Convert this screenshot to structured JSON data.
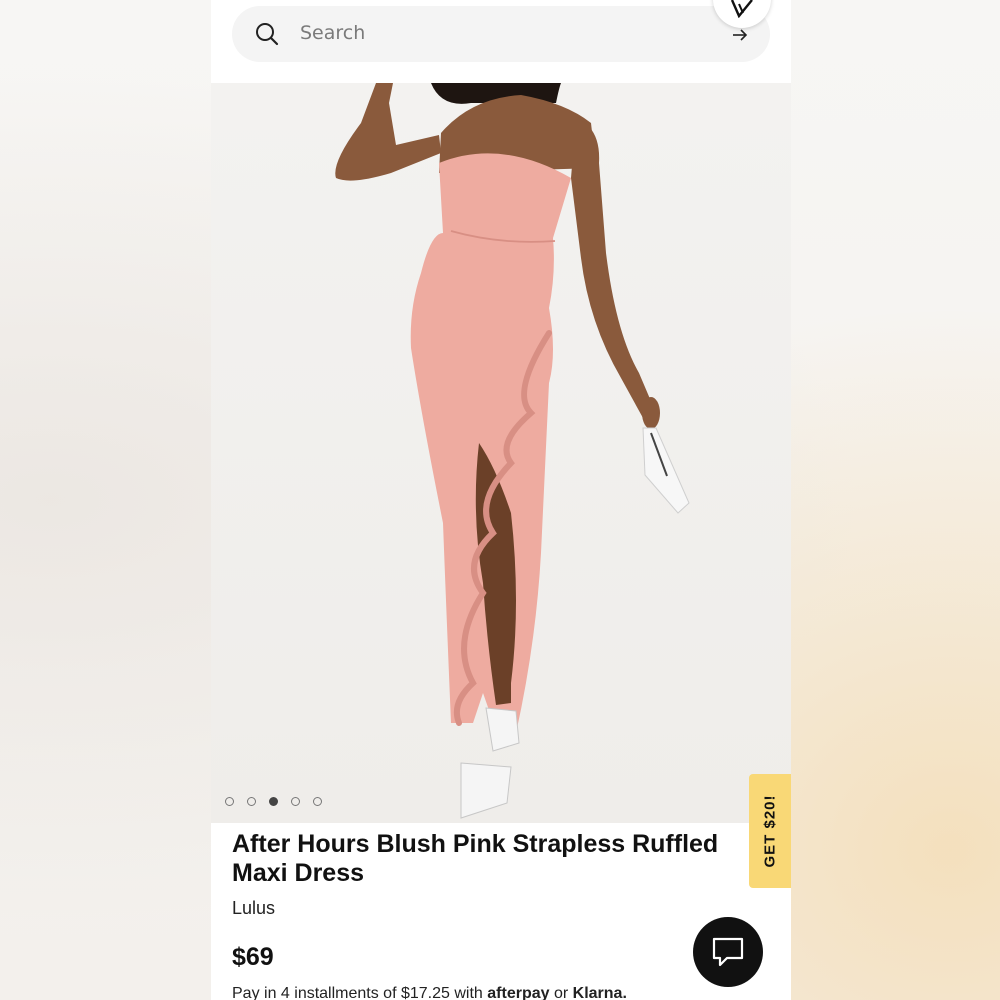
{
  "search": {
    "placeholder": "Search",
    "icon": "search-icon",
    "submit_icon": "arrow-right-icon"
  },
  "brand_badge": {
    "icon": "brand-logo-icon"
  },
  "carousel": {
    "total": 5,
    "active_index": 2
  },
  "product": {
    "title": "After Hours Blush Pink Strapless Ruffled Maxi Dress",
    "brand": "Lulus",
    "price": "$69",
    "installments_text": "Pay in 4 installments of $17.25 with",
    "afterpay": "afterpay",
    "or_text": "or",
    "klarna": "Klarna."
  },
  "promo": {
    "label": "GET $20!"
  },
  "chat": {
    "icon": "chat-bubble-icon"
  },
  "colors": {
    "promo_yellow": "#f9d876",
    "dress_pink": "#eeaba0",
    "chat_bg": "#111111"
  }
}
